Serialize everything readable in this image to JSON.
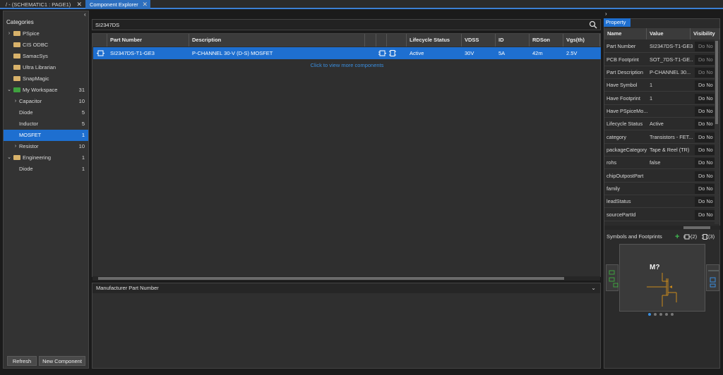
{
  "tabs": [
    {
      "label": "/ - (SCHEMATIC1 : PAGE1)",
      "close": "✕"
    },
    {
      "label": "Component Explorer",
      "close": "✕"
    }
  ],
  "categories": {
    "header": "Categories",
    "items": [
      {
        "label": "PSpice",
        "count": "",
        "icon": "folder-icon",
        "expander": "›"
      },
      {
        "label": "CIS ODBC",
        "count": "",
        "icon": "folder-icon",
        "expander": ""
      },
      {
        "label": "SamacSys",
        "count": "",
        "icon": "folder-icon",
        "expander": ""
      },
      {
        "label": "Ultra Librarian",
        "count": "",
        "icon": "folder-icon",
        "expander": ""
      },
      {
        "label": "SnapMagic",
        "count": "",
        "icon": "folder-icon",
        "expander": ""
      },
      {
        "label": "My Workspace",
        "count": "31",
        "icon": "workspace-icon",
        "expander": "⌄"
      },
      {
        "label": "Capacitor",
        "count": "10",
        "icon": "",
        "expander": "›"
      },
      {
        "label": "Diode",
        "count": "5",
        "icon": "",
        "expander": ""
      },
      {
        "label": "Inductor",
        "count": "5",
        "icon": "",
        "expander": ""
      },
      {
        "label": "MOSFET",
        "count": "1",
        "icon": "",
        "expander": ""
      },
      {
        "label": "Resistor",
        "count": "10",
        "icon": "",
        "expander": "›"
      },
      {
        "label": "Engineering",
        "count": "1",
        "icon": "folder-icon",
        "expander": "⌄"
      },
      {
        "label": "Diode",
        "count": "1",
        "icon": "",
        "expander": ""
      }
    ],
    "refresh_label": "Refresh",
    "new_component_label": "New Component"
  },
  "search": {
    "value": "SI2347DS"
  },
  "grid": {
    "columns": [
      "Part Number",
      "Description",
      "",
      "",
      "",
      "Lifecycle Status",
      "VDSS",
      "ID",
      "RDSon",
      "Vgs(th)"
    ],
    "row": {
      "part_number": "SI2347DS-T1-GE3",
      "description": "P-CHANNEL 30-V (D-S) MOSFET",
      "lifecycle": "Active",
      "vdss": "30V",
      "id": "5A",
      "rdson": "42m",
      "vgs": "2.5V"
    },
    "more_link": "Click to view more components"
  },
  "manufacturer": {
    "label": "Manufacturer Part Number"
  },
  "property": {
    "tab": "Property",
    "columns": [
      "Name",
      "Value",
      "Visibility"
    ],
    "rows": [
      {
        "name": "Part Number",
        "value": "SI2347DS-T1-GE3",
        "vis": "Do No"
      },
      {
        "name": "PCB Footprint",
        "value": "SOT_7DS-T1-GE...",
        "vis": "Do No"
      },
      {
        "name": "Part Description",
        "value": "P-CHANNEL 30...",
        "vis": "Do No"
      },
      {
        "name": "Have Symbol",
        "value": "1",
        "vis": "Do No"
      },
      {
        "name": "Have Footprint",
        "value": "1",
        "vis": "Do No"
      },
      {
        "name": "Have PSpiceMo...",
        "value": "",
        "vis": "Do No"
      },
      {
        "name": "Lifecycle Status",
        "value": "Active",
        "vis": "Do No"
      },
      {
        "name": "category",
        "value": "Transistors - FET...",
        "vis": "Do No"
      },
      {
        "name": "packageCategory",
        "value": "Tape & Reel (TR)",
        "vis": "Do No"
      },
      {
        "name": "rohs",
        "value": "false",
        "vis": "Do No"
      },
      {
        "name": "chipOutpostPart",
        "value": "",
        "vis": "Do No"
      },
      {
        "name": "family",
        "value": "",
        "vis": "Do No"
      },
      {
        "name": "leadStatus",
        "value": "",
        "vis": "Do No"
      },
      {
        "name": "sourcePartId",
        "value": "",
        "vis": "Do No"
      }
    ]
  },
  "symbols": {
    "label": "Symbols and Footprints",
    "symbol_count": "(2)",
    "footprint_count": "(3)",
    "preview_ref": "M?"
  },
  "colors": {
    "accent": "#1e6fd0",
    "link": "#3a8fe0"
  }
}
